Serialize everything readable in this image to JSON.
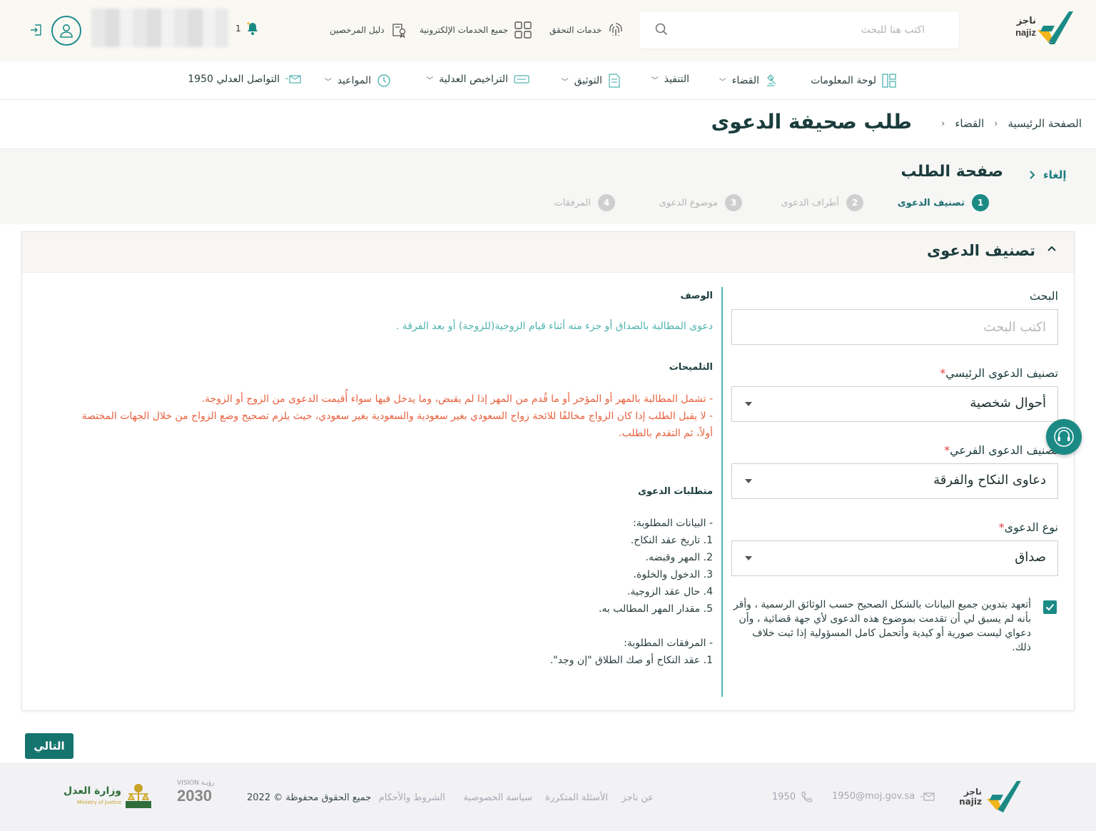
{
  "header": {
    "logo_ar": "ناجز",
    "logo_en": "najiz",
    "search_placeholder": "اكتب هنا للبحث",
    "links": {
      "verification": "خدمات التحقق",
      "all_services": "جميع الخدمات الإلكترونية",
      "licensed_guide": "دليل المرخصين"
    },
    "notification_count": "1"
  },
  "nav": {
    "items": [
      {
        "label": "لوحة المعلومات"
      },
      {
        "label": "القضاء"
      },
      {
        "label": "التنفيذ"
      },
      {
        "label": "التوثيق"
      },
      {
        "label": "التراخيص العدلية"
      },
      {
        "label": "المواعيد"
      },
      {
        "label": "التواصل العدلي 1950"
      }
    ]
  },
  "breadcrumb": {
    "home": "الصفحة الرئيسية",
    "judiciary": "القضاء"
  },
  "page_title": "طلب صحيفة الدعوى",
  "request": {
    "title": "صفحة الطلب",
    "cancel": "إلغاء",
    "steps": [
      {
        "num": "1",
        "label": "تصنيف الدعوى"
      },
      {
        "num": "2",
        "label": "أطراف الدعوى"
      },
      {
        "num": "3",
        "label": "موضوع الدعوى"
      },
      {
        "num": "4",
        "label": "المرفقات"
      }
    ]
  },
  "card": {
    "title": "تصنيف الدعوى",
    "form": {
      "search_label": "البحث",
      "search_placeholder": "اكتب البحث",
      "main_category_label": "تصنيف الدعوى الرئيسي",
      "main_category_value": "أحوال شخصية",
      "sub_category_label": "تصنيف الدعوى الفرعي",
      "sub_category_value": "دعاوى النكاح والفرقة",
      "type_label": "نوع الدعوى",
      "type_value": "صداق",
      "pledge": "أتعهد بتدوين جميع البيانات بالشكل الصحيح حسب الوثائق الرسمية ، وأقر بأنه لم يسبق لي أن تقدمت بموضوع هذه الدعوى لأي جهة قضائية ، وأن دعواي ليست صورية أو كيدية وأتحمل كامل المسؤولية إذا ثبت خلاف ذلك."
    },
    "description": {
      "heading": "الوصف",
      "text": "دعوى المطالبة بالصداق أو جزء منه أثناء قيام الزوجية(للزوجة) أو بعد الفرقة .",
      "hints_heading": "التلميحات",
      "hint1": "- تشمل المطالبة بالمهر أو المؤخر أو ما قُدم من المهر إذا لم يقبض، وما يدخل فيها سواء أُقيمت الدعوى من الزوج أو الزوجة.",
      "hint2": "- لا يقبل الطلب إذا كان الزواج مخالفًا للائحة زواج السعودي بغير سعودية والسعودية بغير سعودي، حيث يلزم تصحيح وضع الزواج من خلال الجهات المختصة أولاً، ثم التقدم بالطلب.",
      "requirements_heading": "متطلبات الدعوى",
      "required_data": "- البيانات المطلوبة:",
      "data_items": [
        "1. تاريخ عقد النكاح.",
        "2. المهر وقبضه.",
        "3. الدخول والخلوة.",
        "4. حال عقد الزوجية.",
        "5. مقدار المهر المطالب به."
      ],
      "required_attachments": "- المرفقات المطلوبة:",
      "attachment_items": [
        "1. عقد النكاح أو صك الطلاق \"إن وجد\"."
      ]
    }
  },
  "next_button": "التالي",
  "footer": {
    "email": "1950@moj.gov.sa",
    "phone": "1950",
    "links": [
      "عن ناجز",
      "الأسئلة المتكررة",
      "سياسة الخصوصية",
      "الشروط والأحكام"
    ],
    "copyright": "جميع الحقوق محفوظة © 2022",
    "vision": "2030",
    "vision_label": "VISION رؤيـة",
    "ministry_ar": "وزارة العدل",
    "ministry_en": "Ministry of Justice"
  },
  "colors": {
    "primary": "#1b8a85",
    "dark": "#1b3c3c",
    "hint": "#e8613e",
    "required": "#e0443e"
  }
}
